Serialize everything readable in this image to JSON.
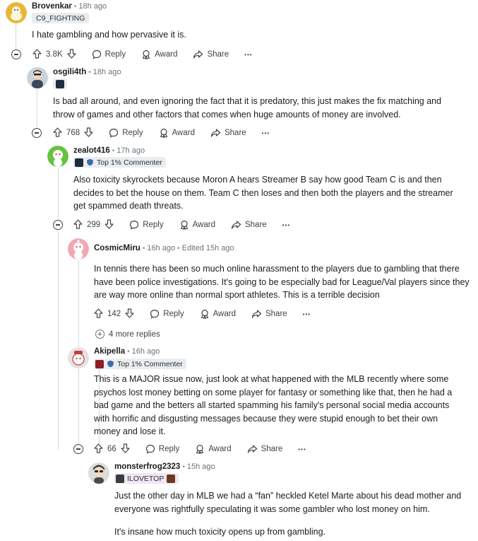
{
  "comments": [
    {
      "username": "Brovenkar",
      "time": "18h ago",
      "flair": "C9_FIGHTING",
      "body": [
        "I hate gambling and how pervasive it is."
      ],
      "score": "3.8K",
      "avatar_color": "#e8b73a"
    },
    {
      "username": "osgili4th",
      "time": "18h ago",
      "body": [
        "Is bad all around, and even ignoring the fact that it is predatory, this just makes the fix matching and throw of games and other factors that comes when huge amounts of money are involved."
      ],
      "score": "768",
      "avatar_color": "#c9d3dc"
    },
    {
      "username": "zealot416",
      "time": "17h ago",
      "flair": "Top 1% Commenter",
      "body": [
        "Also toxicity skyrockets because Moron A hears Streamer B say how good Team C is and then decides to bet the house on them. Team C then loses and then both the players and the streamer get spammed death threats."
      ],
      "score": "299",
      "avatar_color": "#67c241"
    },
    {
      "username": "CosmicMiru",
      "time": "16h ago",
      "edited": "Edited 15h ago",
      "body": [
        "In tennis there has been so much online harassment to the players due to gambling that there have been police investigations. It's going to be especially bad for League/Val players since they are way more online than normal sport athletes. This is a terrible decision"
      ],
      "score": "142",
      "more_replies": "4 more replies",
      "avatar_color": "#f1a8b3"
    },
    {
      "username": "Akipella",
      "time": "16h ago",
      "flair": "Top 1% Commenter",
      "body": [
        "This is a MAJOR issue now, just look at what happened with the MLB recently where some psychos lost money betting on some player for fantasy or something like that, then he had a bad game and the betters all started spamming his family's personal social media accounts with horrific and disgusting messages because they were stupid enough to bet their own money and lose it."
      ],
      "score": "66",
      "avatar_color": "#e7e2e2"
    },
    {
      "username": "monsterfrog2323",
      "time": "15h ago",
      "flair": "ILOVETOP",
      "body": [
        "Just the other day in MLB we had a “fan” heckled Ketel Marte about his dead mother and everyone was rightfully speculating it was some gambler who lost money on him.",
        "It's insane how much toxicity opens up from gambling."
      ],
      "avatar_color": "#3a3a3a"
    }
  ],
  "actions": {
    "reply": "Reply",
    "award": "Award",
    "share": "Share",
    "overflow": "•••"
  },
  "icons": [
    "upvote-icon",
    "downvote-icon",
    "reply-icon",
    "award-icon",
    "share-icon",
    "collapse-icon",
    "expand-icon",
    "shield-icon"
  ]
}
